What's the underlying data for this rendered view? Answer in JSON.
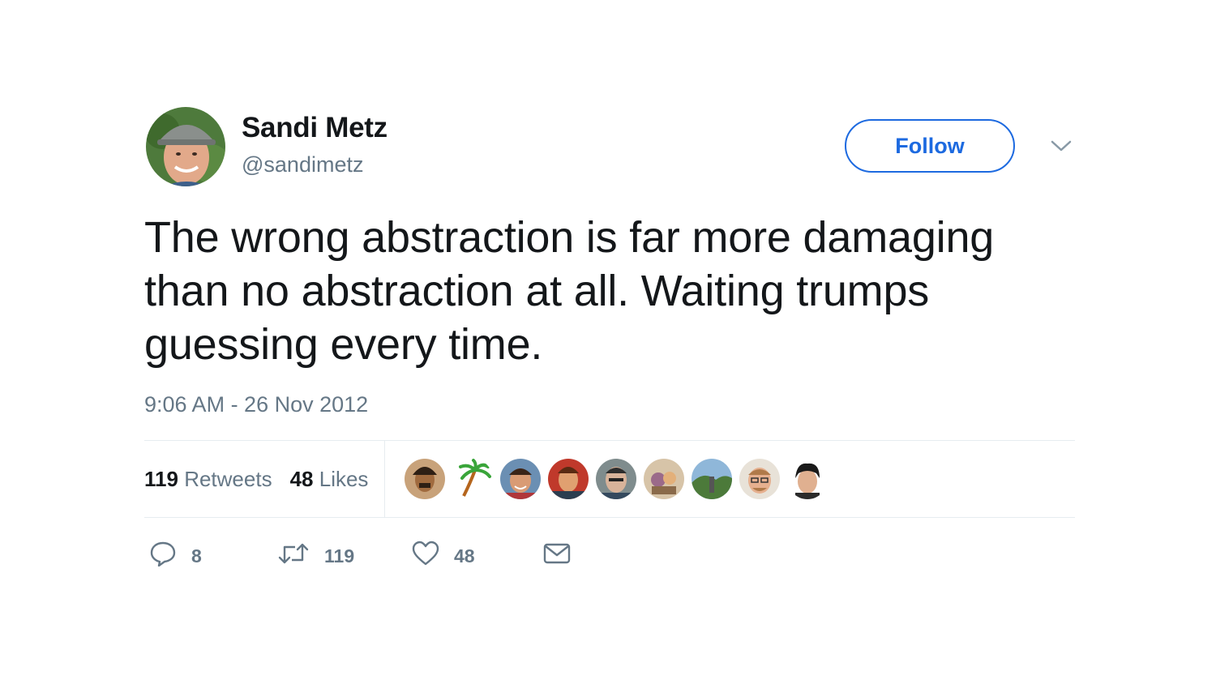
{
  "user": {
    "display_name": "Sandi Metz",
    "handle": "@sandimetz",
    "avatar_icon": "user-avatar"
  },
  "follow_button": {
    "label": "Follow",
    "color": "#1d6ae0"
  },
  "menu_icon": "chevron-down-icon",
  "tweet": {
    "text": "The wrong abstraction is far more damaging than no abstraction at all. Waiting trumps guessing every time.",
    "timestamp": "9:06 AM - 26 Nov 2012"
  },
  "stats": {
    "retweets_count": "119",
    "retweets_label": "Retweets",
    "likes_count": "48",
    "likes_label": "Likes"
  },
  "likers": [
    {
      "icon": "liker-avatar-1"
    },
    {
      "icon": "palm-tree-avatar"
    },
    {
      "icon": "liker-avatar-3"
    },
    {
      "icon": "liker-avatar-4"
    },
    {
      "icon": "liker-avatar-5"
    },
    {
      "icon": "liker-avatar-6"
    },
    {
      "icon": "liker-avatar-7"
    },
    {
      "icon": "liker-avatar-8"
    },
    {
      "icon": "liker-avatar-9"
    }
  ],
  "actions": {
    "reply_count": "8",
    "retweet_count": "119",
    "like_count": "48"
  },
  "colors": {
    "text": "#14171a",
    "secondary": "#657786",
    "accent": "#1d6ae0",
    "divider": "#e6ecf0"
  }
}
